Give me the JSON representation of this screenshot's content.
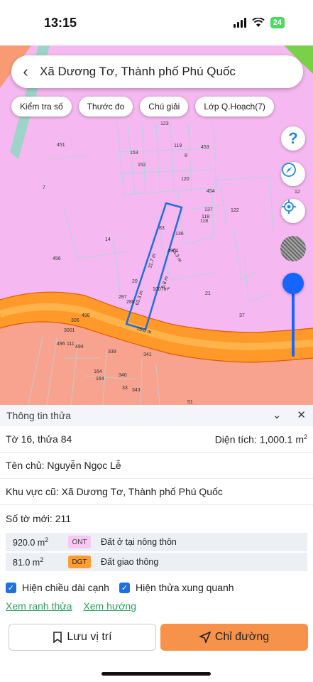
{
  "status": {
    "time": "13:15",
    "battery": "24"
  },
  "map": {
    "search_title": "Xã Dương Tơ, Thành phố Phú Quốc",
    "chips": [
      "Kiểm tra số",
      "Thước đo",
      "Chú giải",
      "Lớp Q.Hoạch(7)"
    ],
    "help_icon_label": "?",
    "parcel_numbers": [
      "123",
      "451",
      "153",
      "119",
      "453",
      "8",
      "152",
      "120",
      "454",
      "7",
      "137",
      "122",
      "118",
      "83",
      "136",
      "14",
      "456",
      "21",
      "37",
      "20",
      "287",
      "288",
      "498",
      "306",
      "3001",
      "495",
      "111",
      "494",
      "339",
      "340",
      "164",
      "164",
      "33",
      "343",
      "341",
      "51",
      "118",
      "12"
    ],
    "dimensions": [
      "31.7 m",
      "15.3 m",
      "63.3 m",
      "6.8 m",
      "15.0 m",
      "1007m²",
      "4901"
    ]
  },
  "panel": {
    "header": "Thông tin thửa",
    "sheet_parcel": "Tờ 16, thửa 84",
    "area_label": "Diện tích: 1,000.1 m",
    "area_sup": "2",
    "owner": "Tên chủ: Nguyễn Ngọc Lễ",
    "old_area": "Khu vực cũ: Xã Dương Tơ, Thành phố Phú Quốc",
    "new_sheet": "Số tờ mới: 211",
    "land_uses": [
      {
        "area": "920.0 m",
        "sup": "2",
        "code": "ONT",
        "desc": "Đất ở tại nông thôn"
      },
      {
        "area": "81.0 m",
        "sup": "2",
        "code": "DGT",
        "desc": "Đất giao thông"
      }
    ],
    "check_edges": "Hiện chiều dài cạnh",
    "check_neighbors": "Hiện thửa xung quanh",
    "link_boundary": "Xem ranh thửa",
    "link_direction": "Xem hướng",
    "btn_save": "Lưu vị trí",
    "btn_route": "Chỉ đường"
  }
}
